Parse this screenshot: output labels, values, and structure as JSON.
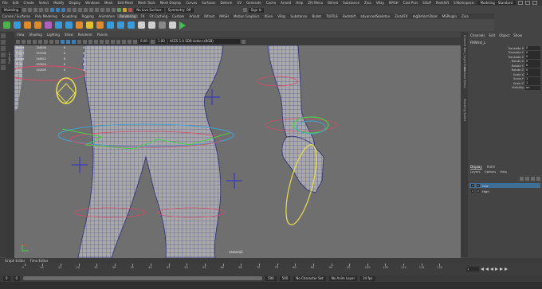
{
  "menubar": {
    "items": [
      "File",
      "Edit",
      "Create",
      "Select",
      "Modify",
      "Display",
      "Windows",
      "Mesh",
      "Edit Mesh",
      "Mesh Tools",
      "Mesh Display",
      "Curves",
      "Surfaces",
      "Deform",
      "UV",
      "Generate",
      "Cache",
      "Arnold",
      "Help",
      "ZIV Menu",
      "Bifrost",
      "Substance",
      "Ziva",
      "VRay",
      "MASH",
      "Cast Pros",
      "SOuP",
      "Redshift",
      "Sculpt Tools",
      "MorphMaker",
      "Camera Tools",
      "Lookdev",
      "JobPilot",
      "Ziva",
      "Overlays",
      "Cogs",
      "More",
      "Help"
    ],
    "workspace_label": "Workspace:",
    "workspace_value": "Modeling - Standard"
  },
  "statusline": {
    "mode": "Modeling",
    "no_live_surface": "No Live Surface",
    "symmetry": "Symmetry: Off",
    "sign_in": "Sign In"
  },
  "shelf": {
    "tabs": [
      "Curves / Surfaces",
      "Poly Modeling",
      "Sculpting",
      "Rigging",
      "Animation",
      "Rendering",
      "FX",
      "FX Caching",
      "Custom",
      "Arnold",
      "Bifrost",
      "MASH",
      "Motion Graphics",
      "XGen",
      "VRay",
      "Substance",
      "Bullet",
      "TURTLE",
      "Redshift",
      "advancedSkeleton",
      "ZivaVFX",
      "mgDeformTools",
      "MSPlugin",
      "Ziva"
    ],
    "active_tab": "Rendering"
  },
  "viewport": {
    "menus": [
      "View",
      "Shading",
      "Lighting",
      "Show",
      "Renderer",
      "Panels"
    ],
    "exposure": "0.00",
    "gamma": "1.00",
    "color_space": "ACES 1.0 SDR-video (sRGB)",
    "camera_label": "camera1",
    "hud": [
      {
        "label": "Verts",
        "a": "148830",
        "b": "0",
        "c": "0"
      },
      {
        "label": "Edges",
        "a": "297640",
        "b": "0",
        "c": "0"
      },
      {
        "label": "Faces",
        "a": "148812",
        "b": "0",
        "c": "0"
      },
      {
        "label": "Tris",
        "a": "297624",
        "b": "0",
        "c": "0"
      },
      {
        "label": "UVs",
        "a": "152839",
        "b": "0",
        "c": "0"
      }
    ]
  },
  "left_panel_label": "Outliner",
  "side_tabs": [
    "Channel Box / Layer Editor",
    "Attribute Editor",
    "Modeling Toolkit"
  ],
  "channelbox": {
    "menus": [
      "Channels",
      "Edit",
      "Object",
      "Show"
    ],
    "object_name": "FKWrist_L",
    "attributes": [
      {
        "name": "Translate X",
        "value": "0"
      },
      {
        "name": "Translate Y",
        "value": "0"
      },
      {
        "name": "Translate Z",
        "value": "0"
      },
      {
        "name": "Rotate X",
        "value": "0"
      },
      {
        "name": "Rotate Y",
        "value": "0"
      },
      {
        "name": "Rotate Z",
        "value": "0"
      },
      {
        "name": "Scale X",
        "value": "1"
      },
      {
        "name": "Scale Y",
        "value": "1"
      },
      {
        "name": "Scale Z",
        "value": "1"
      },
      {
        "name": "Visibility",
        "value": "on"
      }
    ]
  },
  "layers": {
    "tabs": [
      "Display",
      "Anim"
    ],
    "active_tab": "Display",
    "menus": [
      "Layers",
      "Options",
      "Help"
    ],
    "items": [
      {
        "name": "Low",
        "v": "V",
        "p": "P",
        "selected": true
      },
      {
        "name": "High",
        "v": "V",
        "p": "P",
        "selected": false
      }
    ]
  },
  "bottom_tabs": [
    "Graph Editor",
    "Time Editor"
  ],
  "timeline": {
    "ticks": [
      "5",
      "10",
      "15",
      "20",
      "25",
      "30",
      "35",
      "40",
      "45",
      "50",
      "55",
      "60",
      "65",
      "70",
      "75",
      "80",
      "85",
      "90",
      "95",
      "100",
      "105",
      "110",
      "115",
      "120"
    ],
    "current_frame": "1"
  },
  "range": {
    "start": "0",
    "playback_start": "0",
    "playback_end": "500",
    "end": "500",
    "character_set": "No Character Set",
    "anim_layer": "No Anim Layer",
    "fps": "24 fps"
  }
}
